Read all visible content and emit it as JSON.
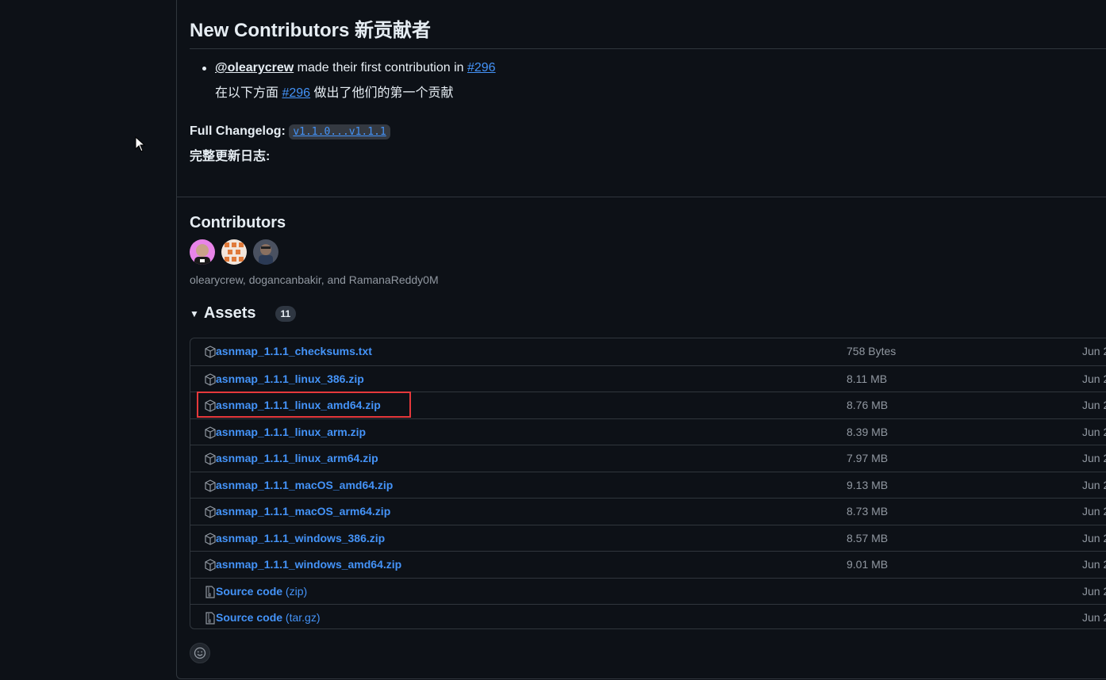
{
  "new_contributors": {
    "heading": "New Contributors 新贡献者",
    "mention": "@olearycrew",
    "made_text": " made their first contribution in ",
    "pr_link": "#296",
    "cn_prefix": "在以下方面 ",
    "cn_pr_link": "#296",
    "cn_suffix": " 做出了他们的第一个贡献"
  },
  "changelog": {
    "label": "Full Changelog",
    "colon": ": ",
    "compare_link": "v1.1.0...v1.1.1",
    "cn_label": "完整更新日志:"
  },
  "contributors": {
    "title": "Contributors",
    "names": "olearycrew, dogancanbakir, and RamanaReddy0M"
  },
  "assets": {
    "title": "Assets",
    "count": "11",
    "items": [
      {
        "name": "asnmap_1.1.1_checksums.txt",
        "suffix": "",
        "size": "758 Bytes",
        "date": "Jun 2"
      },
      {
        "name": "asnmap_1.1.1_linux_386.zip",
        "suffix": "",
        "size": "8.11 MB",
        "date": "Jun 2"
      },
      {
        "name": "asnmap_1.1.1_linux_amd64.zip",
        "suffix": "",
        "size": "8.76 MB",
        "date": "Jun 2"
      },
      {
        "name": "asnmap_1.1.1_linux_arm.zip",
        "suffix": "",
        "size": "8.39 MB",
        "date": "Jun 2"
      },
      {
        "name": "asnmap_1.1.1_linux_arm64.zip",
        "suffix": "",
        "size": "7.97 MB",
        "date": "Jun 2"
      },
      {
        "name": "asnmap_1.1.1_macOS_amd64.zip",
        "suffix": "",
        "size": "9.13 MB",
        "date": "Jun 2"
      },
      {
        "name": "asnmap_1.1.1_macOS_arm64.zip",
        "suffix": "",
        "size": "8.73 MB",
        "date": "Jun 2"
      },
      {
        "name": "asnmap_1.1.1_windows_386.zip",
        "suffix": "",
        "size": "8.57 MB",
        "date": "Jun 2"
      },
      {
        "name": "asnmap_1.1.1_windows_amd64.zip",
        "suffix": "",
        "size": "9.01 MB",
        "date": "Jun 2"
      },
      {
        "name": "Source code",
        "suffix": " (zip)",
        "size": "",
        "date": "Jun 2"
      },
      {
        "name": "Source code",
        "suffix": " (tar.gz)",
        "size": "",
        "date": "Jun 2"
      }
    ]
  },
  "colors": {
    "background": "#0d1117",
    "link": "#4493f8",
    "muted": "#9198a1",
    "border": "#30363d",
    "highlight": "#e5383b"
  }
}
